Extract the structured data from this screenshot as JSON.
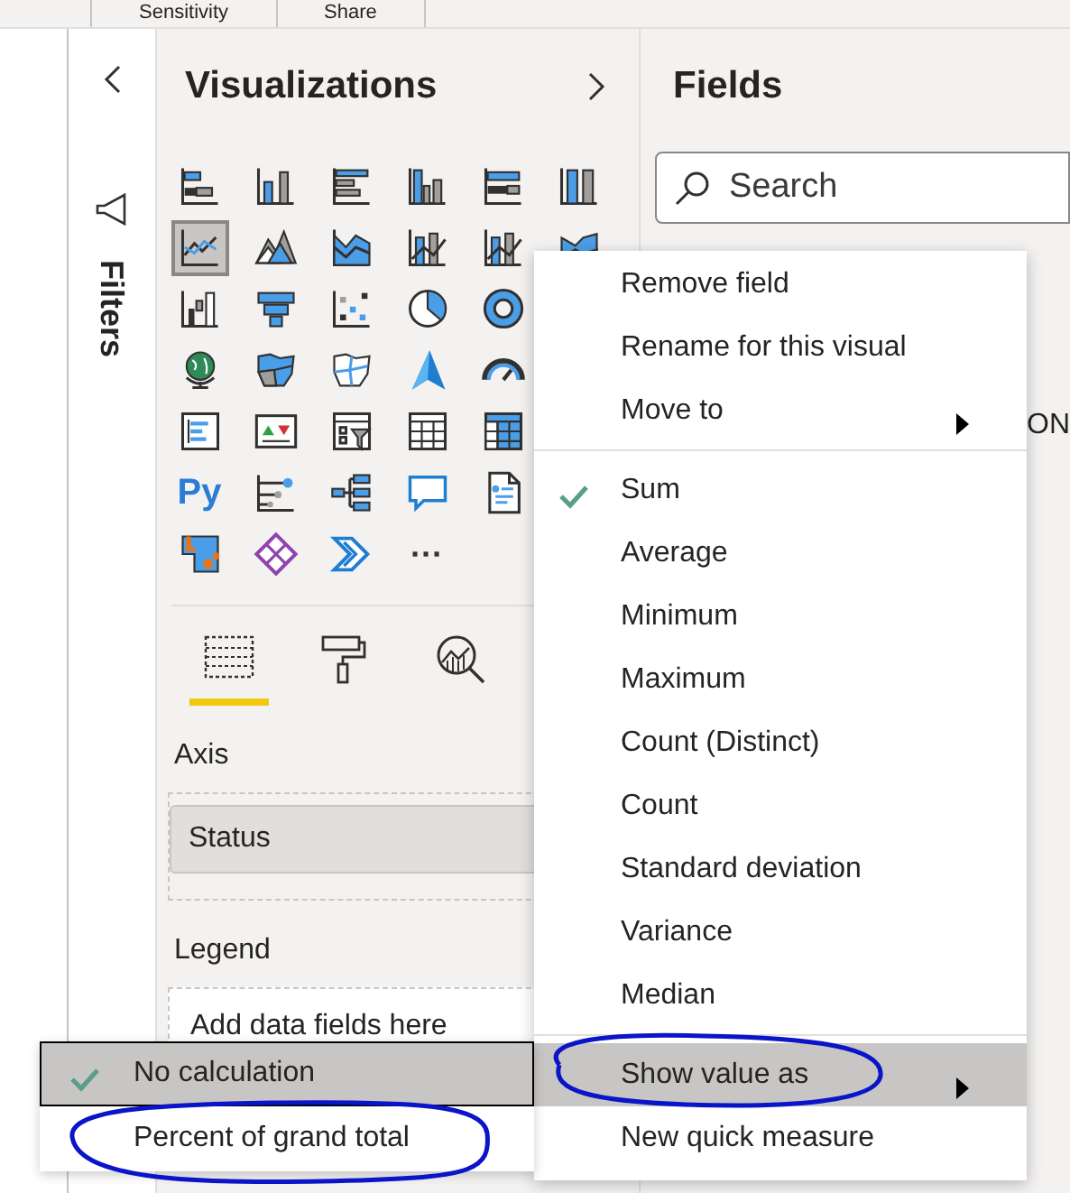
{
  "ribbon": {
    "tabs": [
      "Sensitivity",
      "Share"
    ]
  },
  "filters_pane": {
    "title": "Filters"
  },
  "visualizations": {
    "title": "Visualizations",
    "rows": [
      [
        {
          "kind": "stacked-bar",
          "selected": false
        },
        {
          "kind": "stacked-column",
          "selected": false
        },
        {
          "kind": "clustered-bar",
          "selected": false
        },
        {
          "kind": "clustered-column",
          "selected": false
        },
        {
          "kind": "bar-100",
          "selected": false
        },
        {
          "kind": "column-100",
          "selected": false
        }
      ],
      [
        {
          "kind": "line",
          "selected": true
        },
        {
          "kind": "area",
          "selected": false
        },
        {
          "kind": "stacked-area",
          "selected": false
        },
        {
          "kind": "line-column",
          "selected": false
        },
        {
          "kind": "line-column",
          "selected": false
        },
        {
          "kind": "ribbon",
          "selected": false
        }
      ],
      [
        {
          "kind": "waterfall",
          "selected": false
        },
        {
          "kind": "funnel",
          "selected": false
        },
        {
          "kind": "scatter",
          "selected": false
        },
        {
          "kind": "pie",
          "selected": false
        },
        {
          "kind": "donut",
          "selected": false
        }
      ],
      [
        {
          "kind": "globe",
          "selected": false
        },
        {
          "kind": "filled-map",
          "selected": false
        },
        {
          "kind": "shape-map",
          "selected": false
        },
        {
          "kind": "arrow",
          "selected": false
        },
        {
          "kind": "gauge",
          "selected": false
        }
      ],
      [
        {
          "kind": "card",
          "selected": false
        },
        {
          "kind": "kpi",
          "selected": false
        },
        {
          "kind": "slicer",
          "selected": false
        },
        {
          "kind": "table",
          "selected": false
        },
        {
          "kind": "matrix",
          "selected": false
        }
      ],
      [
        {
          "kind": "text",
          "text": "Py",
          "selected": false
        },
        {
          "kind": "influencers",
          "selected": false
        },
        {
          "kind": "decomposition",
          "selected": false
        },
        {
          "kind": "speech",
          "selected": false
        },
        {
          "kind": "document",
          "selected": false
        }
      ],
      [
        {
          "kind": "power-apps",
          "selected": false
        },
        {
          "kind": "diamond",
          "selected": false
        },
        {
          "kind": "chevron",
          "selected": false
        },
        {
          "kind": "text",
          "text": "···",
          "selected": false
        }
      ]
    ],
    "pane_tabs": [
      {
        "kind": "fields",
        "selected": true
      },
      {
        "kind": "format",
        "selected": false
      },
      {
        "kind": "analytics",
        "selected": false
      }
    ],
    "wells": [
      {
        "label": "Axis",
        "field": "Status"
      },
      {
        "label": "Legend",
        "hint": "Add data fields here"
      }
    ]
  },
  "fields": {
    "title": "Fields",
    "search": {
      "placeholder": "Search"
    },
    "partial_text": "ON"
  },
  "context_menu": {
    "groups": [
      [
        {
          "label": "Remove field",
          "checked": false,
          "has_submenu": false,
          "selected": false
        },
        {
          "label": "Rename for this visual",
          "checked": false,
          "has_submenu": false,
          "selected": false
        },
        {
          "label": "Move to",
          "checked": false,
          "has_submenu": true,
          "selected": false
        }
      ],
      [
        {
          "label": "Sum",
          "checked": true,
          "has_submenu": false,
          "selected": false
        },
        {
          "label": "Average",
          "checked": false,
          "has_submenu": false,
          "selected": false
        },
        {
          "label": "Minimum",
          "checked": false,
          "has_submenu": false,
          "selected": false
        },
        {
          "label": "Maximum",
          "checked": false,
          "has_submenu": false,
          "selected": false
        },
        {
          "label": "Count (Distinct)",
          "checked": false,
          "has_submenu": false,
          "selected": false
        },
        {
          "label": "Count",
          "checked": false,
          "has_submenu": false,
          "selected": false
        },
        {
          "label": "Standard deviation",
          "checked": false,
          "has_submenu": false,
          "selected": false
        },
        {
          "label": "Variance",
          "checked": false,
          "has_submenu": false,
          "selected": false
        },
        {
          "label": "Median",
          "checked": false,
          "has_submenu": false,
          "selected": false
        }
      ],
      [
        {
          "label": "Show value as",
          "checked": false,
          "has_submenu": true,
          "selected": true
        },
        {
          "label": "New quick measure",
          "checked": false,
          "has_submenu": false,
          "selected": false
        }
      ]
    ]
  },
  "submenu": {
    "items": [
      {
        "label": "No calculation",
        "checked": true,
        "selected": true
      },
      {
        "label": "Percent of grand total",
        "checked": false,
        "selected": false
      }
    ]
  }
}
